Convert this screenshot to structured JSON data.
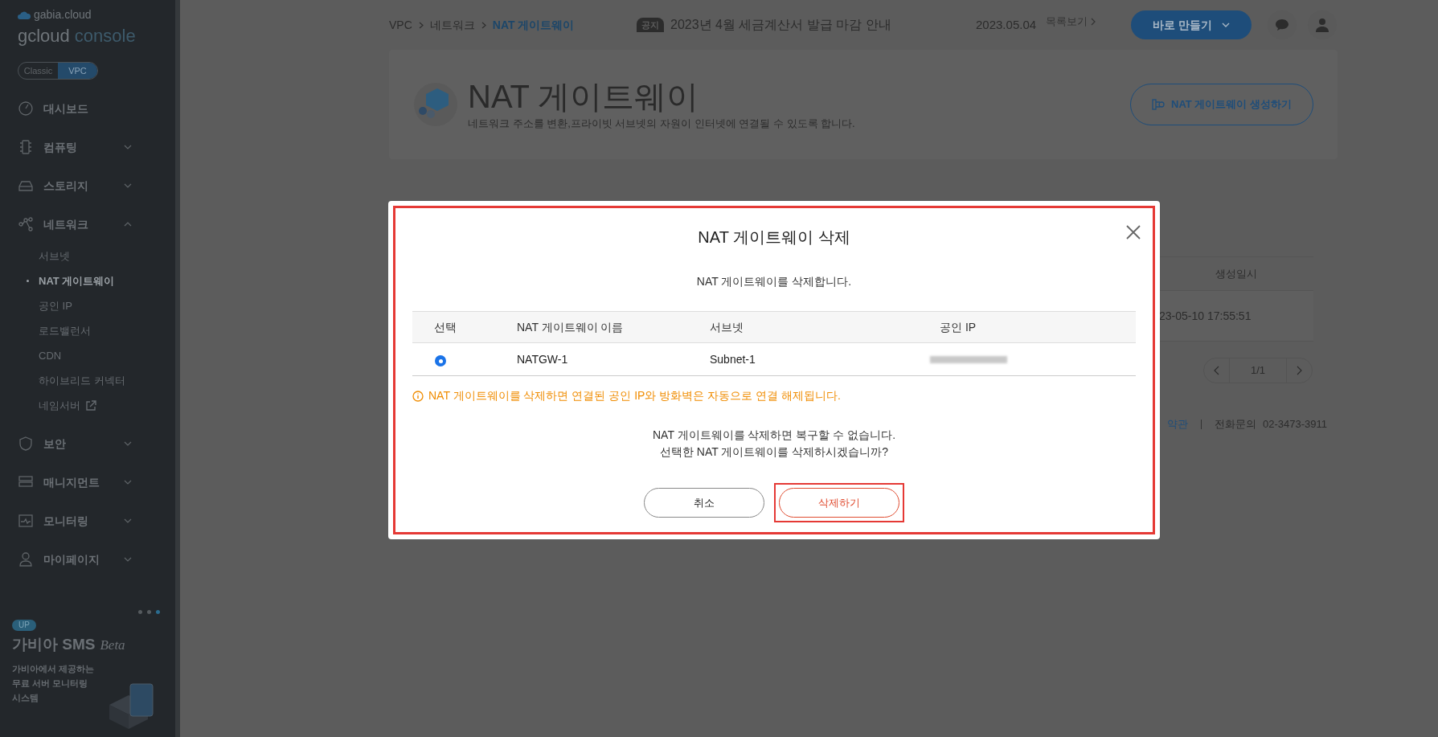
{
  "sidebar": {
    "brand": "gabia.cloud",
    "logo": [
      "gcloud",
      "console"
    ],
    "mode_toggle": [
      {
        "label": "Classic",
        "selected": false
      },
      {
        "label": "VPC",
        "selected": true
      }
    ],
    "menu": [
      {
        "label": "대시보드",
        "kind": "link"
      },
      {
        "label": "컴퓨팅",
        "kind": "group",
        "expanded": false
      },
      {
        "label": "스토리지",
        "kind": "group",
        "expanded": false
      },
      {
        "label": "네트워크",
        "kind": "group",
        "expanded": true,
        "children": [
          {
            "label": "서브넷",
            "selected": false,
            "external": false
          },
          {
            "label": "NAT 게이트웨이",
            "selected": true,
            "external": false
          },
          {
            "label": "공인 IP",
            "selected": false,
            "external": false
          },
          {
            "label": "로드밸런서",
            "selected": false,
            "external": false
          },
          {
            "label": "CDN",
            "selected": false,
            "external": false
          },
          {
            "label": "하이브리드 커넥터",
            "selected": false,
            "external": false
          },
          {
            "label": "네임서버",
            "selected": false,
            "external": true
          }
        ]
      },
      {
        "label": "보안",
        "kind": "group",
        "expanded": false
      },
      {
        "label": "매니지먼트",
        "kind": "group",
        "expanded": false
      },
      {
        "label": "모니터링",
        "kind": "group",
        "expanded": false
      },
      {
        "label": "마이페이지",
        "kind": "group",
        "expanded": false
      }
    ],
    "banner": {
      "dots": [
        {
          "selected": false
        },
        {
          "selected": false
        },
        {
          "selected": true
        }
      ],
      "badge": "UP",
      "title": "가비아 SMS",
      "title_suffix": "Beta",
      "text": [
        "가비아에서 제공하는",
        "무료 서버 모니터링",
        "시스템"
      ]
    }
  },
  "header": {
    "breadcrumb": [
      {
        "label": "VPC",
        "selected": false
      },
      {
        "label": "네트워크",
        "selected": false
      },
      {
        "label": "NAT 게이트웨이",
        "selected": true
      }
    ],
    "notice": {
      "badge": "공지",
      "text": "2023년 4월 세금계산서 발급 마감 안내",
      "date": "2023.05.04",
      "more": "목록보기"
    },
    "create_button": "바로 만들기"
  },
  "page_header": {
    "title": "NAT 게이트웨이",
    "description": "네트워크 주소를 변환,프라이빗 서브넷의 자원이 인터넷에 연결될 수 있도록 합니다.",
    "create_button": "NAT 게이트웨이 생성하기"
  },
  "table": {
    "column": "생성일시",
    "cell": "23-05-10 17:55:51",
    "pagination": "1/1"
  },
  "footer": {
    "link": "약관",
    "phone_label": "전화문의",
    "phone": "02-3473-3911"
  },
  "modal": {
    "title": "NAT 게이트웨이 삭제",
    "message": "NAT 게이트웨이를 삭제합니다.",
    "columns": [
      "선택",
      "NAT 게이트웨이 이름",
      "서브넷",
      "공인 IP"
    ],
    "rows": [
      {
        "selected": true,
        "name": "NATGW-1",
        "subnet": "Subnet-1"
      }
    ],
    "warning": "NAT 게이트웨이를 삭제하면 연결된 공인 IP와 방화벽은 자동으로 연결 해제됩니다.",
    "confirm": [
      "NAT 게이트웨이를 삭제하면 복구할 수 없습니다.",
      "선택한 NAT 게이트웨이를 삭제하시겠습니까?"
    ],
    "cancel_button": "취소",
    "delete_button": "삭제하기"
  }
}
